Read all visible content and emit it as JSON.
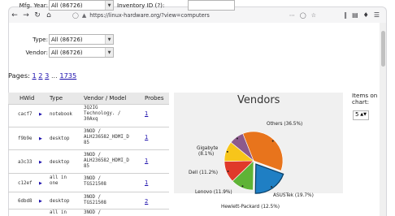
{
  "browser": {
    "url": "https://linux-hardware.org/?view=computers"
  },
  "filters": {
    "mfg_year": {
      "label": "Mfg. Year:",
      "value": "All (86726)"
    },
    "type": {
      "label": "Type:",
      "value": "All (86726)"
    },
    "vendor": {
      "label": "Vendor:",
      "value": "All (86726)"
    },
    "inventory": {
      "label": "Inventory ID (?):",
      "value": ""
    }
  },
  "pagination": {
    "label": "Pages:",
    "pages": [
      "1",
      "2",
      "3",
      "...",
      "1735"
    ]
  },
  "table": {
    "headers": [
      "HWid",
      "Type",
      "Vendor / Model",
      "Probes"
    ],
    "rows": [
      {
        "hwid": "cacf7",
        "type": "notebook",
        "model": [
          "3Q2IG",
          "Technology. /",
          "30Axq"
        ],
        "probes": "1"
      },
      {
        "hwid": "f9b9e",
        "type": "desktop",
        "model": [
          "3NOD /",
          "ALH236582_HDMI_D",
          "85"
        ],
        "probes": "1"
      },
      {
        "hwid": "a3c33",
        "type": "desktop",
        "model": [
          "3NOD /",
          "ALH236582_HDMI_D",
          "85"
        ],
        "probes": "1"
      },
      {
        "hwid": "c12ef",
        "type": "all in one",
        "model": [
          "3NOD /",
          "TGS21508"
        ],
        "probes": "1"
      },
      {
        "hwid": "6dbd8",
        "type": "desktop",
        "model": [
          "3NOD /",
          "TGS21508"
        ],
        "probes": "2"
      },
      {
        "hwid": "",
        "type": "all in",
        "model": [
          "3NOD /"
        ],
        "probes": ""
      }
    ]
  },
  "chart_data": {
    "type": "pie",
    "title": "Vendors",
    "slices": [
      {
        "label": "Others (36.5%)",
        "value": 36.5,
        "color": "#e8741c"
      },
      {
        "label": "ASUSTek (19.7%)",
        "value": 19.7,
        "color": "#1f7fc4"
      },
      {
        "label": "Hewlett-Packard (12.5%)",
        "value": 12.5,
        "color": "#5fb336"
      },
      {
        "label": "Lenovo (11.9%)",
        "value": 11.9,
        "color": "#e0392a"
      },
      {
        "label": "Dell (11.2%)",
        "value": 11.2,
        "color": "#f7c51a"
      },
      {
        "label": "Gigabyte (8.1%)",
        "value": 8.1,
        "color": "#8c5a8c"
      }
    ]
  },
  "chart_controls": {
    "items_label": "Items on chart:",
    "items_value": "5"
  }
}
